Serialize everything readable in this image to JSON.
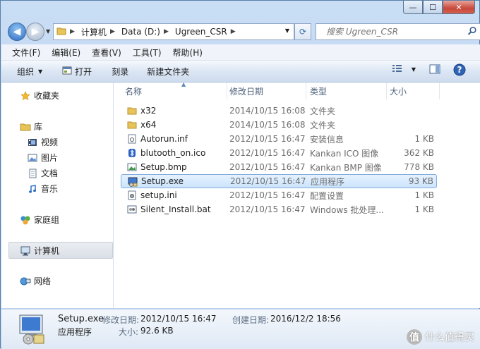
{
  "window": {
    "controls": {
      "minimize": "—",
      "maximize": "☐",
      "close": "✕"
    }
  },
  "address": {
    "segments": [
      "计算机",
      "Data (D:)",
      "Ugreen_CSR"
    ]
  },
  "search": {
    "placeholder": "搜索 Ugreen_CSR"
  },
  "menu": [
    "文件(F)",
    "编辑(E)",
    "查看(V)",
    "工具(T)",
    "帮助(H)"
  ],
  "toolbar": {
    "organize": "组织",
    "open": "打开",
    "burn": "刻录",
    "new_folder": "新建文件夹"
  },
  "nav": {
    "favorites": "收藏夹",
    "libraries": "库",
    "videos": "视频",
    "pictures": "图片",
    "documents": "文档",
    "music": "音乐",
    "homegroup": "家庭组",
    "computer": "计算机",
    "network": "网络"
  },
  "columns": {
    "name": "名称",
    "date": "修改日期",
    "type": "类型",
    "size": "大小"
  },
  "files": [
    {
      "name": "x32",
      "date": "2014/10/15 16:08",
      "type": "文件夹",
      "size": "",
      "icon": "folder-icon"
    },
    {
      "name": "x64",
      "date": "2014/10/15 16:08",
      "type": "文件夹",
      "size": "",
      "icon": "folder-icon"
    },
    {
      "name": "Autorun.inf",
      "date": "2012/10/15 16:47",
      "type": "安装信息",
      "size": "1 KB",
      "icon": "inf-file-icon"
    },
    {
      "name": "blutooth_on.ico",
      "date": "2012/10/15 16:47",
      "type": "Kankan ICO 图像",
      "size": "362 KB",
      "icon": "bluetooth-icon"
    },
    {
      "name": "Setup.bmp",
      "date": "2012/10/15 16:47",
      "type": "Kankan BMP 图像",
      "size": "778 KB",
      "icon": "bmp-file-icon"
    },
    {
      "name": "Setup.exe",
      "date": "2012/10/15 16:47",
      "type": "应用程序",
      "size": "93 KB",
      "icon": "setup-exe-icon"
    },
    {
      "name": "setup.ini",
      "date": "2012/10/15 16:47",
      "type": "配置设置",
      "size": "1 KB",
      "icon": "ini-file-icon"
    },
    {
      "name": "Silent_Install.bat",
      "date": "2012/10/15 16:47",
      "type": "Windows 批处理...",
      "size": "1 KB",
      "icon": "bat-file-icon"
    }
  ],
  "selected_index": 5,
  "details": {
    "filename": "Setup.exe",
    "modified_label": "修改日期:",
    "modified": "2012/10/15 16:47",
    "created_label": "创建日期:",
    "created": "2016/12/2 18:56",
    "type": "应用程序",
    "size_label": "大小:",
    "size": "92.6 KB"
  },
  "watermark": {
    "glyph": "值",
    "text": "什么值得买"
  }
}
